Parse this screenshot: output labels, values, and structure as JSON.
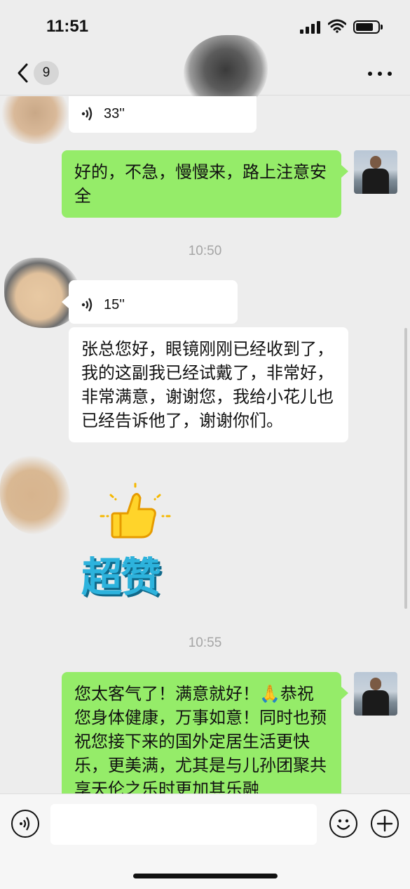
{
  "status_bar": {
    "time": "11:51"
  },
  "nav": {
    "unread_count": "9"
  },
  "messages": [
    {
      "type": "voice",
      "side": "left",
      "duration": "33''"
    },
    {
      "type": "text",
      "side": "right",
      "text": "好的，不急，慢慢来，路上注意安全"
    },
    {
      "type": "timestamp",
      "text": "10:50"
    },
    {
      "type": "voice",
      "side": "left",
      "duration": "15''"
    },
    {
      "type": "text",
      "side": "left",
      "text": "张总您好，眼镜刚刚已经收到了，我的这副我已经试戴了，非常好，非常满意，谢谢您，我给小花儿也已经告诉他了，谢谢你们。"
    },
    {
      "type": "sticker",
      "side": "left",
      "text": "超赞"
    },
    {
      "type": "timestamp",
      "text": "10:55"
    },
    {
      "type": "text",
      "side": "right",
      "text": "您太客气了！满意就好！🙏恭祝您身体健康，万事如意！同时也预祝您接下来的国外定居生活更快乐，更美满，尤其是与儿孙团聚共享天伦之乐时更加其乐融"
    }
  ],
  "colors": {
    "bubble_green": "#95ec69",
    "bubble_white": "#ffffff",
    "background": "#ededed"
  }
}
